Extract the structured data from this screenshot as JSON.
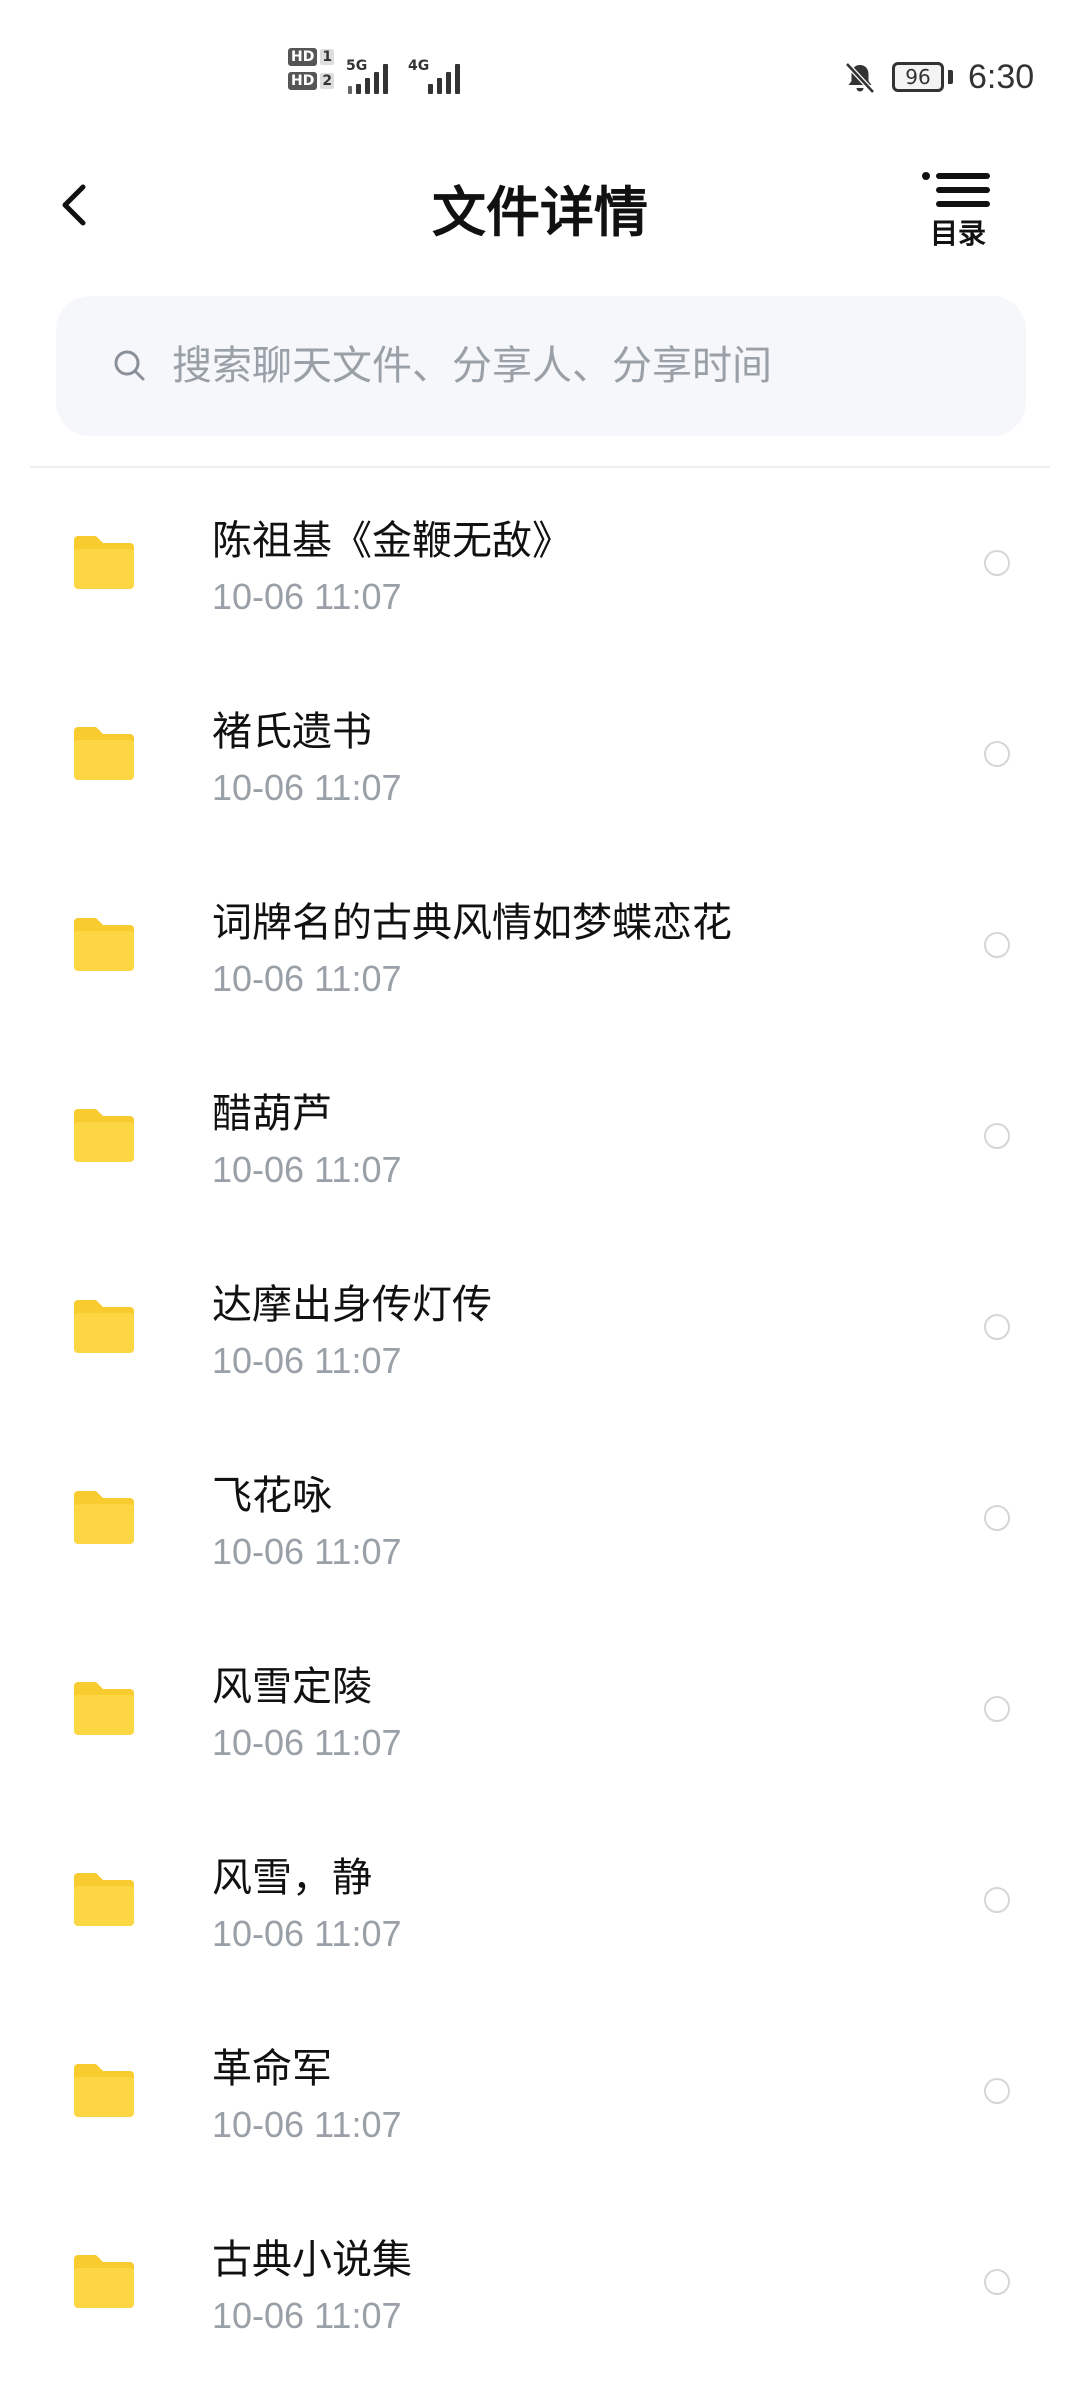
{
  "status_bar": {
    "sim1_badge": "HD",
    "sim1_num": "1",
    "sim2_badge": "HD",
    "sim2_num": "2",
    "network1": "5G",
    "network2": "4G",
    "battery_level": "96",
    "time": "6:30",
    "icons": [
      "signal-icon",
      "bell-off-icon",
      "battery-icon"
    ]
  },
  "header": {
    "title": "文件详情",
    "catalog_label": "目录",
    "icons": [
      "back-arrow-icon",
      "list-icon"
    ]
  },
  "search": {
    "placeholder": "搜索聊天文件、分享人、分享时间",
    "value": ""
  },
  "files": [
    {
      "name": "陈祖基《金鞭无敌》",
      "time": "10-06  11:07"
    },
    {
      "name": "褚氏遗书",
      "time": "10-06  11:07"
    },
    {
      "name": "词牌名的古典风情如梦蝶恋花",
      "time": "10-06  11:07"
    },
    {
      "name": "醋葫芦",
      "time": "10-06  11:07"
    },
    {
      "name": "达摩出身传灯传",
      "time": "10-06  11:07"
    },
    {
      "name": "飞花咏",
      "time": "10-06  11:07"
    },
    {
      "name": "风雪定陵",
      "time": "10-06  11:07"
    },
    {
      "name": "风雪，静",
      "time": "10-06  11:07"
    },
    {
      "name": "革命军",
      "time": "10-06  11:07"
    },
    {
      "name": "古典小说集",
      "time": "10-06  11:07"
    }
  ],
  "colors": {
    "folder": "#FDD643",
    "folder_tab": "#F8CB2E",
    "secondary_text": "#9aa0a8",
    "search_bg": "#f5f7fa"
  }
}
